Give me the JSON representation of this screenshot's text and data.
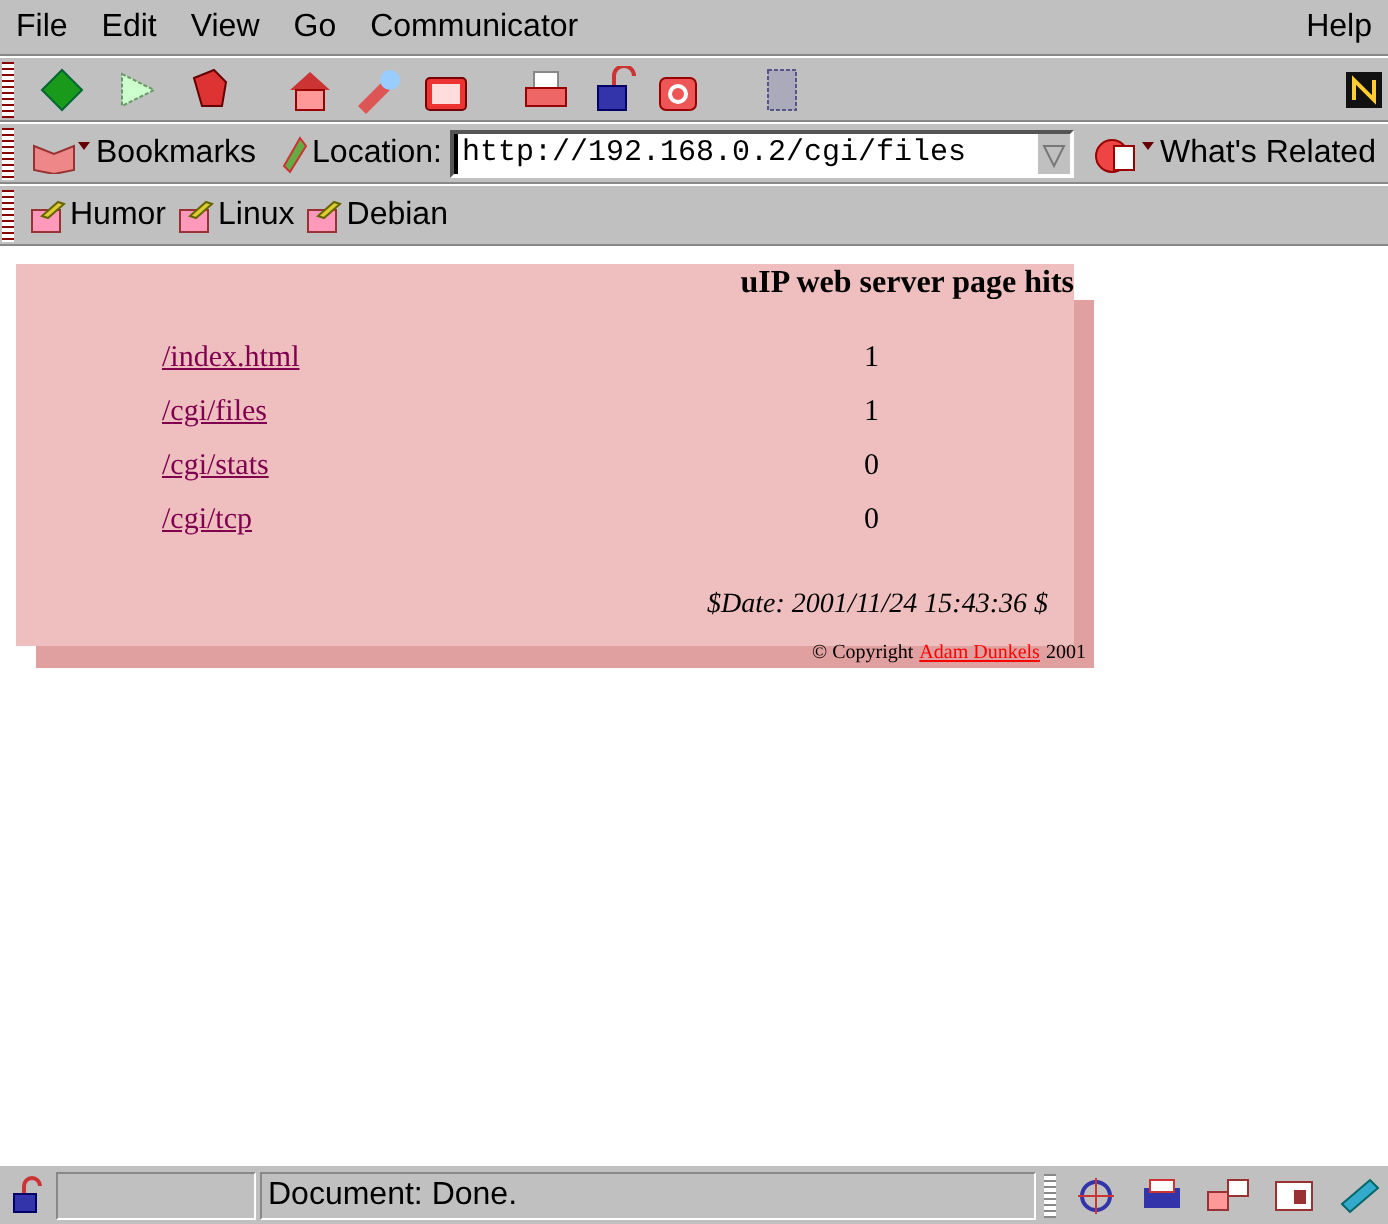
{
  "menu_bar": {
    "items": [
      "File",
      "Edit",
      "View",
      "Go",
      "Communicator"
    ],
    "help": "Help"
  },
  "location_bar": {
    "bookmarks": "Bookmarks",
    "location_label": "Location:",
    "url": "http://192.168.0.2/cgi/files",
    "whats_related": "What's Related"
  },
  "personal_toolbar": [
    "Humor",
    "Linux",
    "Debian"
  ],
  "page": {
    "title": "uIP web server page hits",
    "rows": [
      {
        "path": "/index.html",
        "hits": "1"
      },
      {
        "path": "/cgi/files",
        "hits": "1"
      },
      {
        "path": "/cgi/stats",
        "hits": "0"
      },
      {
        "path": "/cgi/tcp",
        "hits": "0"
      }
    ],
    "date": "$Date: 2001/11/24 15:43:36 $",
    "copyright": "© Copyright",
    "author": "Adam Dunkels",
    "year": "2001"
  },
  "status_bar": {
    "message": "Document: Done."
  }
}
